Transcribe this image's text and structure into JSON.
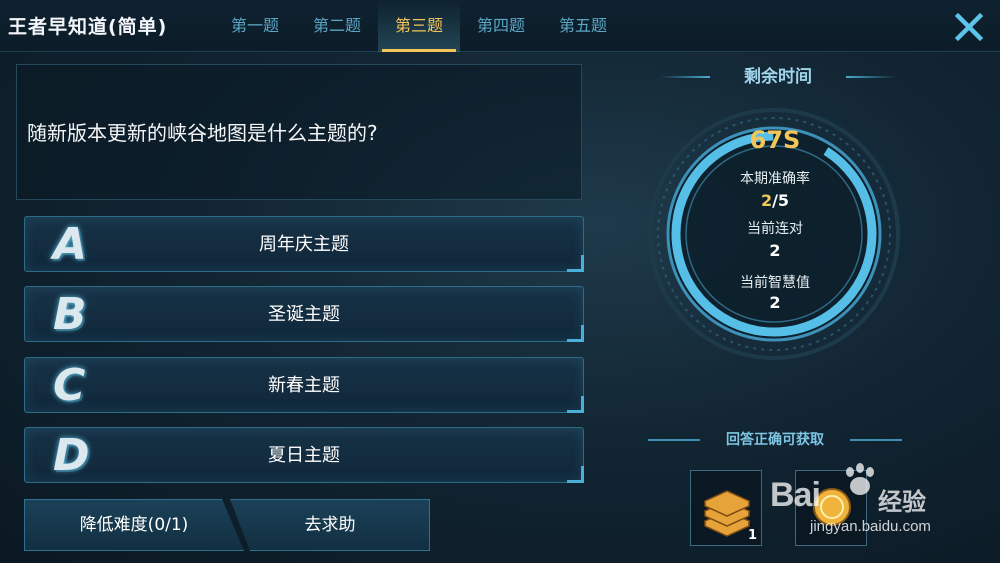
{
  "app": {
    "title": "王者早知道(简单)"
  },
  "tabs": [
    {
      "label": "第一题"
    },
    {
      "label": "第二题"
    },
    {
      "label": "第三题"
    },
    {
      "label": "第四题"
    },
    {
      "label": "第五题"
    }
  ],
  "active_tab": 2,
  "question": {
    "text": "随新版本更新的峡谷地图是什么主题的?"
  },
  "options": [
    {
      "letter": "A",
      "text": "周年庆主题"
    },
    {
      "letter": "B",
      "text": "圣诞主题"
    },
    {
      "letter": "C",
      "text": "新春主题"
    },
    {
      "letter": "D",
      "text": "夏日主题"
    }
  ],
  "actions": {
    "lower_difficulty": "降低难度(0/1)",
    "ask_help": "去求助"
  },
  "timer": {
    "heading": "剩余时间",
    "seconds": "67S",
    "accuracy_label": "本期准确率",
    "accuracy_correct": "2",
    "accuracy_total": "/5",
    "streak_label": "当前连对",
    "streak_value": "2",
    "wisdom_label": "当前智慧值",
    "wisdom_value": "2"
  },
  "reward": {
    "heading": "回答正确可获取",
    "items": [
      {
        "icon": "stacked-coins-icon",
        "count": "1"
      },
      {
        "icon": "gold-coin-icon",
        "count": ""
      }
    ]
  },
  "watermark": {
    "logo": "Bai",
    "cn": "经验",
    "url": "jingyan.baidu.com"
  },
  "colors": {
    "accent_gold": "#f2c65a",
    "accent_blue": "#4ab0d8",
    "tab_inactive": "#5aa6c4",
    "close_icon": "#5cc3ea"
  }
}
